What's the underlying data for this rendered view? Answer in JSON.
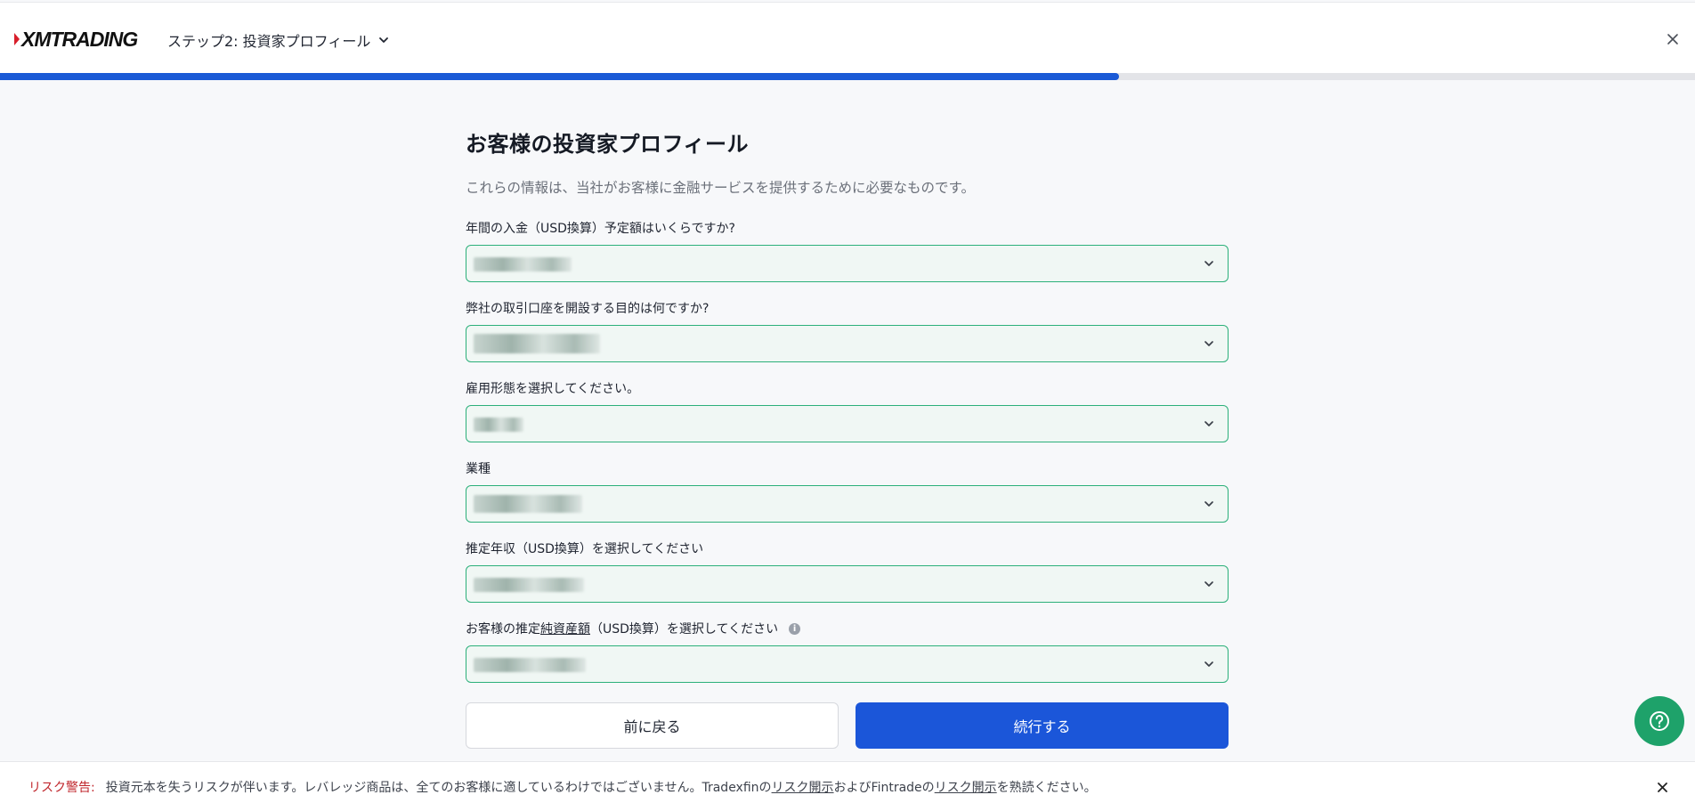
{
  "header": {
    "logo_text": "XMTRADING",
    "step_label": "ステップ2: 投資家プロフィール",
    "progress_percent": 66
  },
  "form": {
    "title": "お客様の投資家プロフィール",
    "subtitle": "これらの情報は、当社がお客様に金融サービスを提供するために必要なものです。",
    "fields": [
      {
        "label": "年間の入金（USD換算）予定額はいくらですか?",
        "value": ""
      },
      {
        "label": "弊社の取引口座を開設する目的は何ですか?",
        "value": ""
      },
      {
        "label": "雇用形態を選択してください。",
        "value": ""
      },
      {
        "label": "業種",
        "value": ""
      },
      {
        "label": "推定年収（USD換算）を選択してください",
        "value": ""
      },
      {
        "label_prefix": "お客様の推定",
        "label_link": "純資産額",
        "label_suffix": "（USD換算）を選択してください",
        "value": ""
      }
    ],
    "back_button": "前に戻る",
    "continue_button": "続行する"
  },
  "risk": {
    "label": "リスク警告:",
    "text_1": "投資元本を失うリスクが伴います。レバレッジ商品は、全てのお客様に適しているわけではございません。Tradexfinの",
    "link_1": "リスク開示",
    "text_2": "およびFintradeの",
    "link_2": "リスク開示",
    "text_3": "を熟読ください。"
  },
  "colors": {
    "accent": "#1b56d9",
    "field_border": "#2cb07a",
    "field_bg": "#f0f7f4",
    "help_fab": "#1ea26a",
    "risk_label": "#c0272d"
  }
}
